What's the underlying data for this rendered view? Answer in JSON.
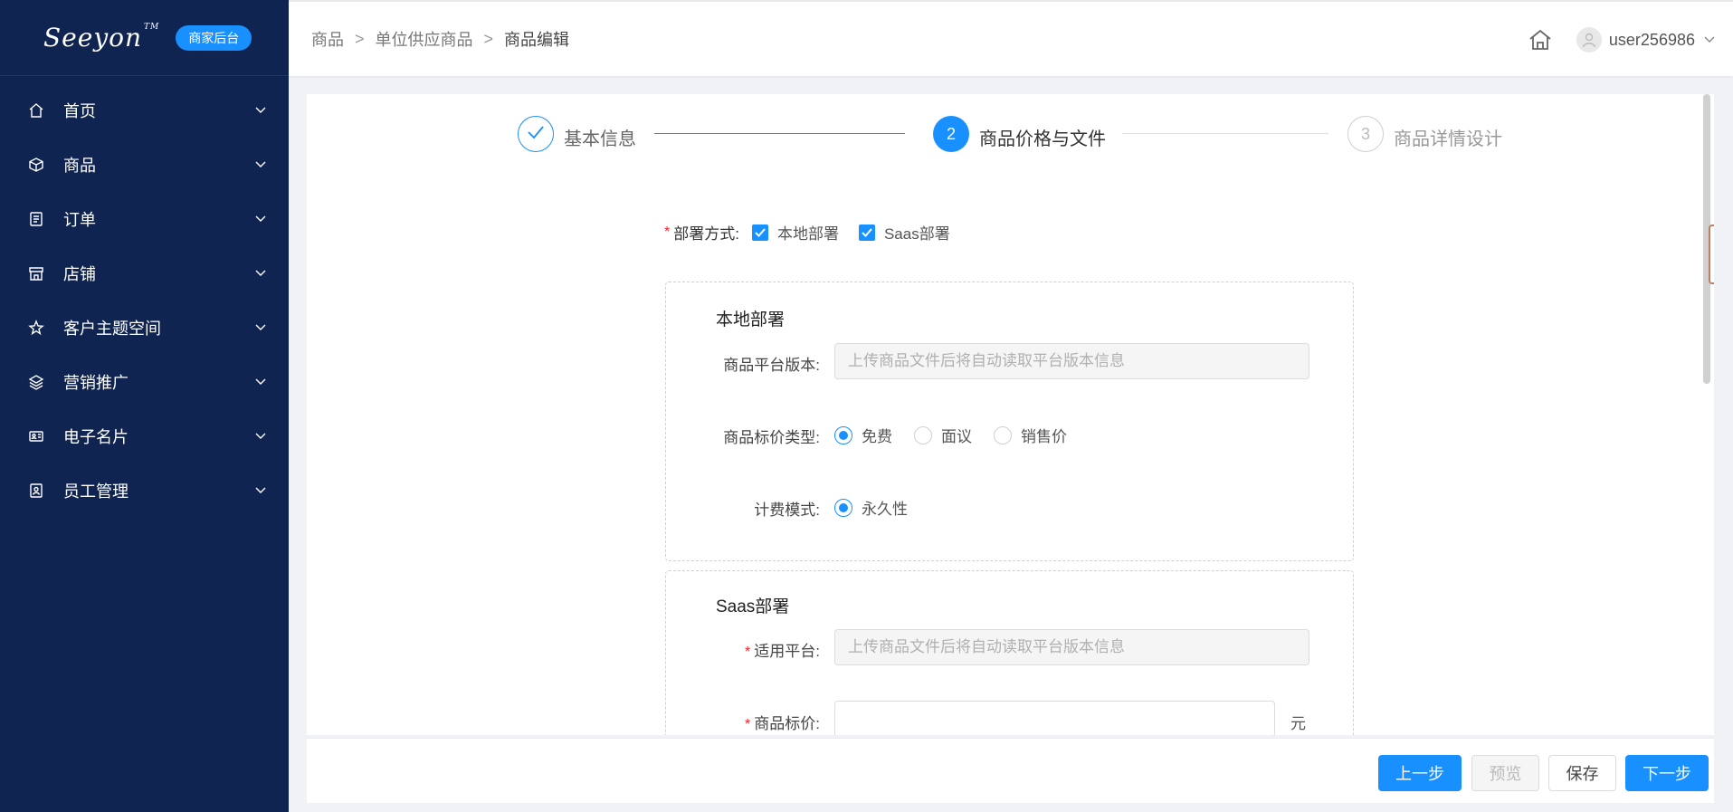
{
  "sidebar": {
    "logo": "Seeyon",
    "logo_tm": "TM",
    "badge": "商家后台",
    "items": [
      {
        "label": "首页",
        "icon": "home-icon"
      },
      {
        "label": "商品",
        "icon": "cube-icon"
      },
      {
        "label": "订单",
        "icon": "order-icon"
      },
      {
        "label": "店铺",
        "icon": "store-icon"
      },
      {
        "label": "客户主题空间",
        "icon": "star-icon"
      },
      {
        "label": "营销推广",
        "icon": "layers-icon"
      },
      {
        "label": "电子名片",
        "icon": "card-icon"
      },
      {
        "label": "员工管理",
        "icon": "staff-icon"
      }
    ]
  },
  "header": {
    "breadcrumb": [
      "商品",
      "单位供应商品",
      "商品编辑"
    ],
    "breadcrumb_sep": ">",
    "username": "user256986"
  },
  "steps": [
    {
      "number": "",
      "label": "基本信息",
      "status": "done"
    },
    {
      "number": "2",
      "label": "商品价格与文件",
      "status": "active"
    },
    {
      "number": "3",
      "label": "商品详情设计",
      "status": "pending"
    }
  ],
  "form": {
    "deploy_label": "部署方式:",
    "deploy_options": [
      "本地部署",
      "Saas部署"
    ],
    "local": {
      "title": "本地部署",
      "version_label": "商品平台版本:",
      "version_placeholder": "上传商品文件后将自动读取平台版本信息",
      "price_type_label": "商品标价类型:",
      "price_types": [
        "免费",
        "面议",
        "销售价"
      ],
      "price_type_selected": "免费",
      "billing_label": "计费模式:",
      "billing_options": [
        "永久性"
      ]
    },
    "saas": {
      "title": "Saas部署",
      "platform_label": "适用平台:",
      "platform_placeholder": "上传商品文件后将自动读取平台版本信息",
      "price_label": "商品标价:",
      "price_value": "",
      "price_unit": "元"
    }
  },
  "footer": {
    "prev": "上一步",
    "preview": "预览",
    "save": "保存",
    "next": "下一步"
  },
  "colors": {
    "sidebar_bg": "#0f2450",
    "primary": "#1890ff",
    "required": "#f5222d"
  }
}
